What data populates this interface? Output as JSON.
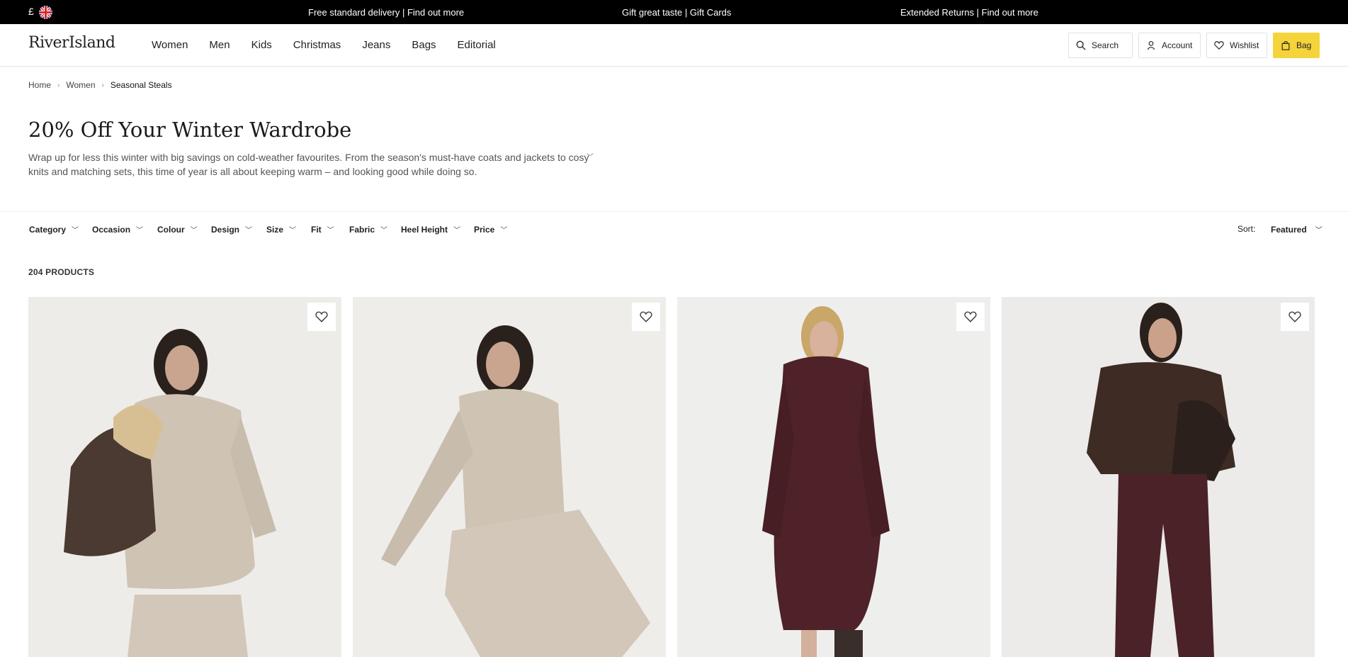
{
  "promo": {
    "currency": "£",
    "messages": [
      "Free standard delivery | Find out more",
      "Gift great taste | Gift Cards",
      "Extended Returns | Find out more"
    ]
  },
  "header": {
    "logo": "RiverIsland",
    "nav": [
      "Women",
      "Men",
      "Kids",
      "Christmas",
      "Jeans",
      "Bags",
      "Editorial"
    ],
    "search_label": "Search",
    "account_label": "Account",
    "wishlist_label": "Wishlist",
    "bag_label": "Bag",
    "bag_color": "#f5d33a"
  },
  "breadcrumb": [
    "Home",
    "Women",
    "Seasonal Steals"
  ],
  "page": {
    "title": "20% Off Your Winter Wardrobe",
    "description": "Wrap up for less this winter with big savings on cold-weather favourites. From the season's must-have coats and jackets to cosy knits and matching sets, this time of year is all about keeping warm – and looking good while doing so."
  },
  "filters": {
    "items": [
      "Category",
      "Occasion",
      "Colour",
      "Design",
      "Size",
      "Fit",
      "Fabric",
      "Heel Height",
      "Price"
    ],
    "sort_label": "Sort:",
    "sort_value": "Featured"
  },
  "product_count": "204 PRODUCTS",
  "products": [
    {
      "image": "model-oatmeal-knit-set-holding-leather-jacket"
    },
    {
      "image": "model-seated-oatmeal-knit-set"
    },
    {
      "image": "model-burgundy-knit-mini-dress"
    },
    {
      "image": "model-brown-leather-jacket-burgundy-trousers"
    }
  ]
}
